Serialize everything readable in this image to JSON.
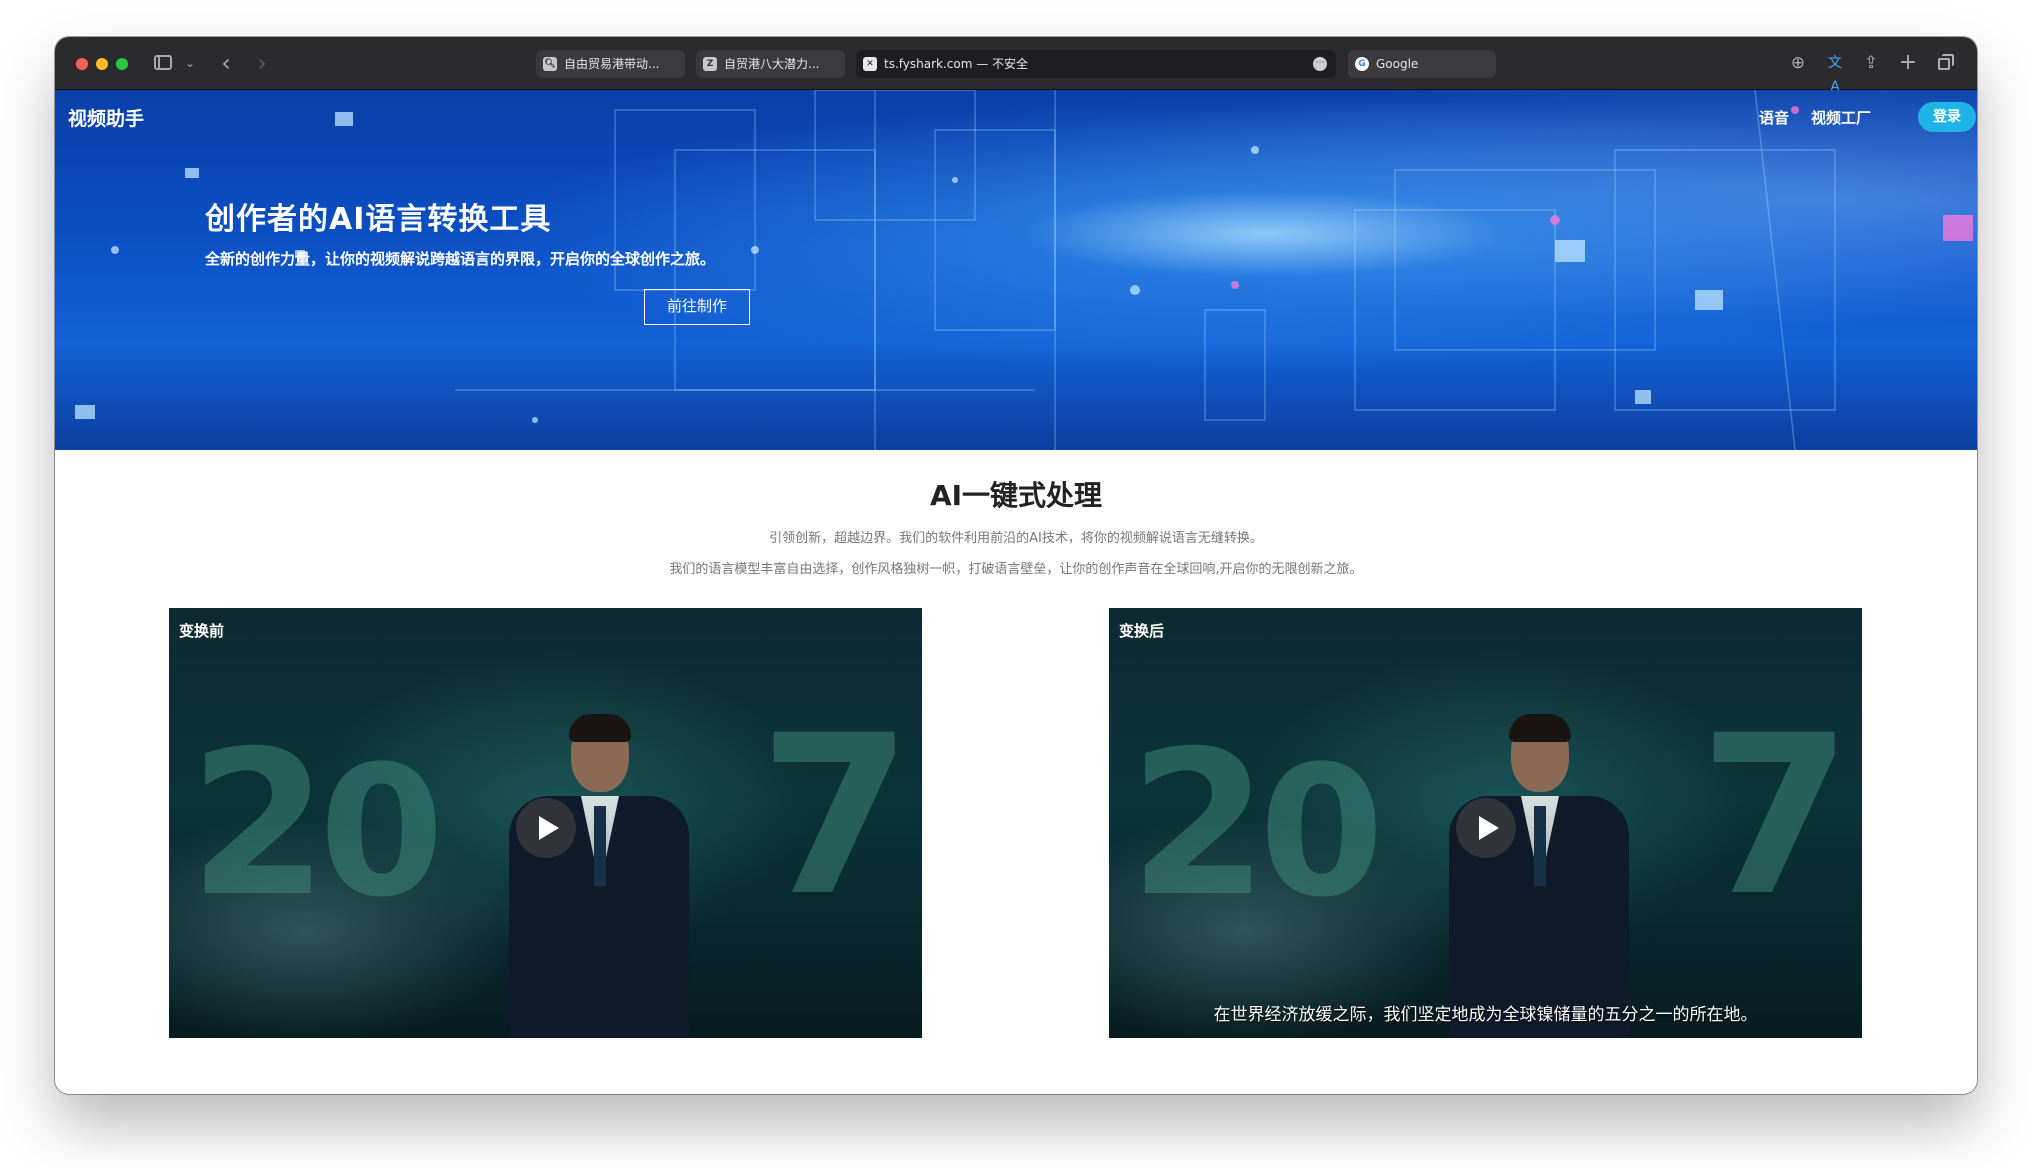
{
  "browser": {
    "tabs": [
      {
        "label": "自由贸易港带动...",
        "favicon": "search-icon"
      },
      {
        "label": "自贸港八大潜力...",
        "favicon": "z-icon"
      },
      {
        "label": "ts.fyshark.com — 不安全",
        "favicon": "site-icon"
      },
      {
        "label": "Google",
        "favicon": "google-icon"
      }
    ],
    "favicon_letters": {
      "tab2": "Z",
      "tab4": "G"
    }
  },
  "header": {
    "brand": "视频助手",
    "nav": [
      "语音",
      "视频工厂"
    ],
    "login": "登录"
  },
  "hero": {
    "title": "创作者的AI语言转换工具",
    "subtitle": "全新的创作力量，让你的视频解说跨越语言的界限，开启你的全球创作之旅。",
    "cta": "前往制作"
  },
  "section": {
    "title": "AI一键式处理",
    "desc1": "引领创新，超越边界。我们的软件利用前沿的AI技术，将你的视频解说语言无缝转换。",
    "desc2": "我们的语言模型丰富自由选择，创作风格独树一帜，打破语言壁垒，让你的创作声音在全球回响,开启你的无限创新之旅。"
  },
  "videos": [
    {
      "label": "变换前",
      "subtitle": ""
    },
    {
      "label": "变换后",
      "subtitle": "在世界经济放缓之际，我们坚定地成为全球镍储量的五分之一的所在地。"
    }
  ],
  "colors": {
    "login_bg": "#1eb4e6",
    "hero_bg": "#0b4fc4"
  }
}
